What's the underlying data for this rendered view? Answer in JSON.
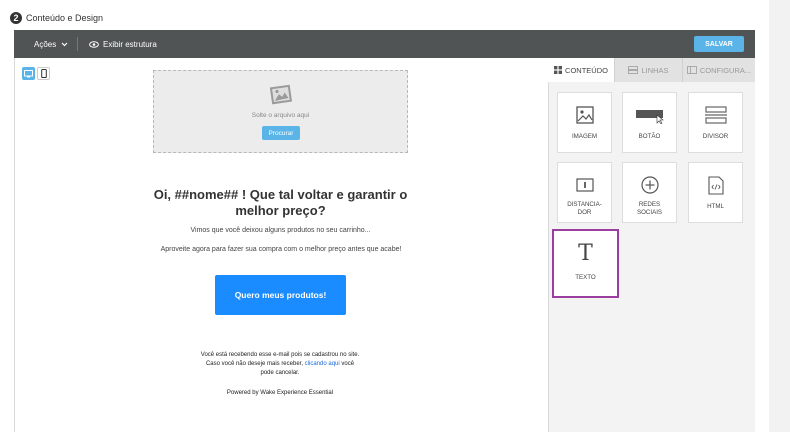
{
  "step": {
    "number": "2",
    "title": "Conteúdo e Design"
  },
  "toolbar": {
    "actions_label": "Ações",
    "structure_label": "Exibir estrutura",
    "save_label": "SALVAR"
  },
  "dropzone": {
    "text": "Solte o arquivo aqui",
    "button": "Procurar"
  },
  "email": {
    "headline": "Oi, ##nome## ! Que tal voltar e garantir o melhor preço?",
    "line1": "Vimos que você deixou alguns produtos no seu carrinho...",
    "line2": "Aproveite agora para fazer sua compra com o melhor preço antes que acabe!",
    "cta": "Quero meus produtos!",
    "footer_line1": "Você está recebendo esse e-mail pois se cadastrou no site.",
    "footer_line2_pre": "Caso você não deseje mais receber,",
    "footer_link": "clicando aqui",
    "footer_line2_post": "você",
    "footer_line3": "pode cancelar.",
    "powered": "Powered by Wake Experience Essential"
  },
  "panel": {
    "tabs": [
      "CONTEÚDO",
      "LINHAS",
      "CONFIGURA..."
    ],
    "blocks": [
      {
        "label": "IMAGEM",
        "icon": "image-icon"
      },
      {
        "label": "BOTÃO",
        "icon": "button-icon"
      },
      {
        "label": "DIVISOR",
        "icon": "divider-icon"
      },
      {
        "label": "DISTANCIA-DOR",
        "label_line1": "DISTANCIA-",
        "label_line2": "DOR",
        "icon": "spacer-icon"
      },
      {
        "label": "REDES SOCIAIS",
        "label_line1": "REDES",
        "label_line2": "SOCIAIS",
        "icon": "social-icon"
      },
      {
        "label": "HTML",
        "icon": "html-icon"
      },
      {
        "label": "TEXTO",
        "icon": "text-icon"
      }
    ]
  },
  "colors": {
    "accent": "#5ab4e8",
    "cta": "#1a8cff",
    "toolbar": "#505455",
    "selected": "#9b3ea0"
  }
}
